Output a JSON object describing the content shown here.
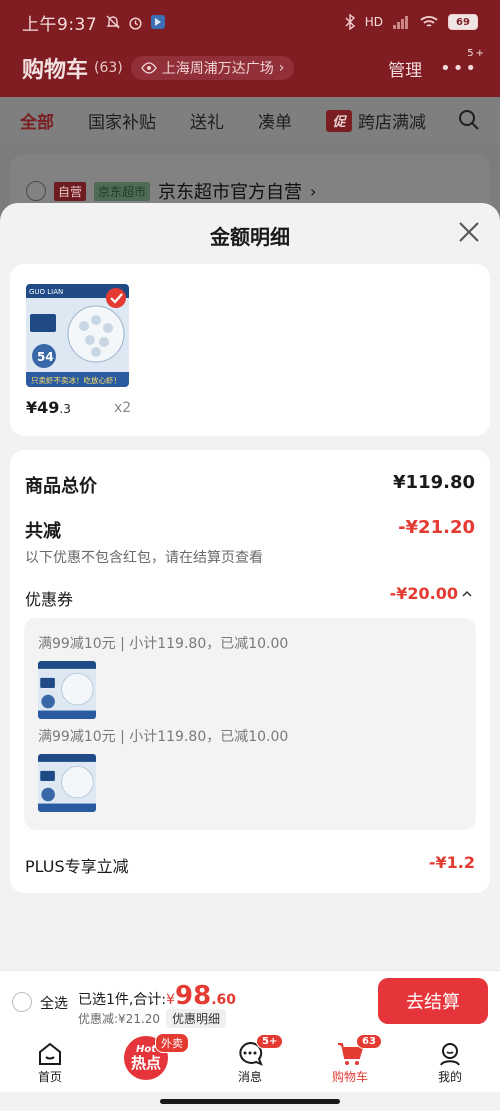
{
  "status_bar": {
    "time": "上午9:37",
    "network": "HD",
    "battery": "69"
  },
  "header": {
    "title": "购物车",
    "count": "(63)",
    "location": "上海周浦万达广场",
    "manage": "管理",
    "more_badge": "5+"
  },
  "tabs": [
    "全部",
    "国家补贴",
    "送礼",
    "凑单",
    "跨店满减"
  ],
  "promo_badge": "促",
  "store": {
    "tag_self": "自营",
    "tag_jd": "京东超市",
    "name": "京东超市官方自营"
  },
  "sheet": {
    "title": "金额明细",
    "product": {
      "price_main": "¥49",
      "price_decimal": ".3",
      "qty": "x2",
      "image_brand": "GUO LIAN",
      "image_slogan": "只卖虾不卖冰！吃放心虾！",
      "image_badge": "54"
    },
    "total_label": "商品总价",
    "total_value": "¥119.80",
    "reduce_label": "共减",
    "reduce_value": "-¥21.20",
    "reduce_note": "以下优惠不包含红包，请在结算页查看",
    "coupon_label": "优惠券",
    "coupon_value": "-¥20.00",
    "coupon_lines": [
      "满99减10元 | 小计119.80，已减10.00",
      "满99减10元 | 小计119.80，已减10.00"
    ],
    "plus_label": "PLUS专享立减",
    "plus_value": "-¥1.2"
  },
  "checkout": {
    "select_all": "全选",
    "summary_prefix": "已选1件,合计:",
    "currency": "¥",
    "amount_int": "98",
    "amount_dec": ".60",
    "discount_text": "优惠减:¥21.20",
    "detail_button": "优惠明细",
    "checkout_button": "去结算"
  },
  "tabbar": {
    "items": [
      "首页",
      "",
      "消息",
      "购物车",
      "我的"
    ],
    "hot_line1": "Hot",
    "hot_line2": "热点",
    "hot_badge": "外卖",
    "msg_badge": "5+",
    "cart_badge": "63"
  },
  "colors": {
    "accent": "#e43a32",
    "header_bg": "#7f1d23"
  }
}
